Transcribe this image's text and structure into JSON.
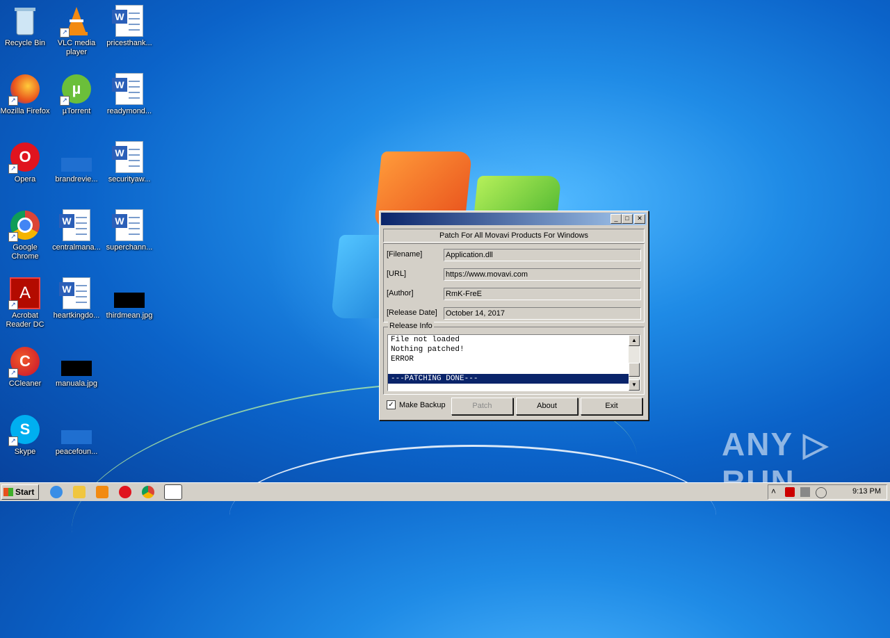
{
  "desktop": {
    "icons": [
      {
        "label": "Recycle Bin"
      },
      {
        "label": "VLC media\nplayer"
      },
      {
        "label": "pricesthank..."
      },
      {
        "label": "Mozilla Firefox"
      },
      {
        "label": "µTorrent"
      },
      {
        "label": "readymond..."
      },
      {
        "label": "Opera"
      },
      {
        "label": "brandrevie..."
      },
      {
        "label": "securityaw..."
      },
      {
        "label": "Google\nChrome"
      },
      {
        "label": "centralmana..."
      },
      {
        "label": "superchann..."
      },
      {
        "label": "Acrobat\nReader DC"
      },
      {
        "label": "heartkingdo..."
      },
      {
        "label": "thirdmean.jpg"
      },
      {
        "label": "CCleaner"
      },
      {
        "label": "manuala.jpg"
      },
      {
        "label": "Skype"
      },
      {
        "label": "peacefoun..."
      }
    ]
  },
  "dialog": {
    "title_buttons": {
      "minimize": "_",
      "maximize": "□",
      "close": "✕"
    },
    "header": "Patch For All Movavi Products For Windows",
    "fields": [
      {
        "label": "[Filename]",
        "value": "Application.dll"
      },
      {
        "label": "[URL]",
        "value": "https://www.movavi.com"
      },
      {
        "label": "[Author]",
        "value": "RmK-FreE"
      },
      {
        "label": "[Release Date]",
        "value": "October 14, 2017"
      }
    ],
    "release_info": {
      "legend": "Release Info",
      "lines": [
        "File not loaded",
        "Nothing patched!",
        "ERROR",
        "",
        "---PATCHING DONE---"
      ],
      "selected_index": 4
    },
    "make_backup": {
      "label": "Make Backup",
      "checked": true,
      "mark": "✓"
    },
    "buttons": {
      "patch": "Patch",
      "about": "About",
      "exit": "Exit"
    }
  },
  "taskbar": {
    "start_label": "Start",
    "clock": "9:13 PM",
    "tray_arrow": "˄"
  },
  "watermark": "ANY ▷ RUN"
}
